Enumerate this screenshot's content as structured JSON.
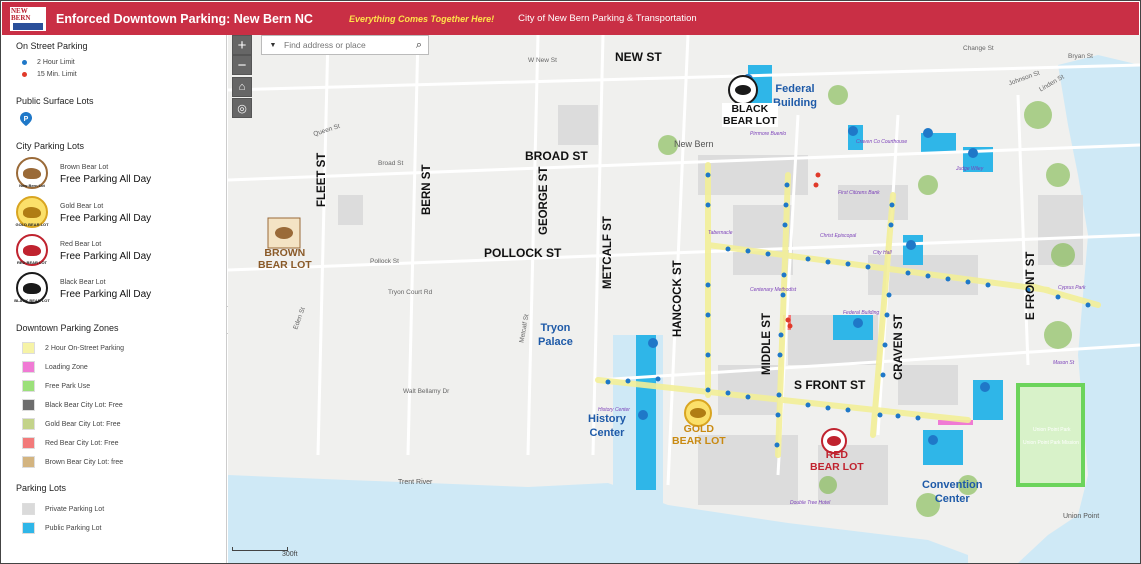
{
  "header": {
    "logo_text": "NEW BERN",
    "title": "Enforced Downtown Parking: New Bern NC",
    "tagline": "Everything Comes Together Here!",
    "link": "City of New Bern Parking & Transportation"
  },
  "legend": {
    "on_street": {
      "heading": "On Street Parking",
      "items": [
        {
          "label": "2 Hour Limit",
          "color": "#1f78c8"
        },
        {
          "label": "15 Min. Limit",
          "color": "#e03a2a"
        }
      ]
    },
    "surface_lots": {
      "heading": "Public Surface Lots"
    },
    "city_lots": {
      "heading": "City Parking Lots",
      "items": [
        {
          "label": "Brown Bear Lot",
          "free": "Free Parking All Day",
          "badge": "New Bern Lot",
          "color": "#9a6a38"
        },
        {
          "label": "Gold Bear Lot",
          "free": "Free Parking All Day",
          "badge": "GOLD BEAR LOT",
          "color": "#d9a521"
        },
        {
          "label": "Red Bear Lot",
          "free": "Free Parking All Day",
          "badge": "RED BEAR LOT",
          "color": "#c0232f"
        },
        {
          "label": "Black Bear Lot",
          "free": "Free Parking All Day",
          "badge": "BLACK BEAR LOT",
          "color": "#1a1a1a"
        }
      ]
    },
    "zones": {
      "heading": "Downtown Parking Zones",
      "items": [
        {
          "label": "2 Hour On-Street Parking",
          "color": "#f6f3a6"
        },
        {
          "label": "Loading Zone",
          "color": "#f07ad4"
        },
        {
          "label": "Free Park Use",
          "color": "#9be07a"
        },
        {
          "label": "Black Bear City Lot: Free",
          "color": "#6d6d6d"
        },
        {
          "label": "Gold Bear City Lot: Free",
          "color": "#c3d38a"
        },
        {
          "label": "Red Bear City Lot: Free",
          "color": "#f27a7a"
        },
        {
          "label": "Brown Bear City Lot: free",
          "color": "#d3b480"
        }
      ]
    },
    "lots": {
      "heading": "Parking Lots",
      "items": [
        {
          "label": "Private Parking Lot",
          "color": "#dadada"
        },
        {
          "label": "Public Parking Lot",
          "color": "#2fb6e8"
        }
      ]
    }
  },
  "map": {
    "search_placeholder": "Find address or place",
    "scale_label": "300ft",
    "streets": {
      "new": "NEW ST",
      "broad": "BROAD ST",
      "pollock": "POLLOCK ST",
      "fleet": "FLEET ST",
      "bern": "BERN ST",
      "george": "GEORGE ST",
      "metcalf": "METCALF ST",
      "hancock": "HANCOCK ST",
      "middle": "MIDDLE ST",
      "craven": "CRAVEN ST",
      "sfront": "S FRONT ST",
      "efront": "E FRONT ST"
    },
    "places": {
      "federal": "Federal\nBuilding",
      "tryon": "Tryon\nPalace",
      "history": "History\nCenter",
      "convention": "Convention\nCenter",
      "newbern": "New Bern",
      "trent": "Trent River",
      "unionpt": "Union Point"
    },
    "lot_labels": {
      "black": "BLACK\nBEAR LOT",
      "brown": "BROWN\nBEAR LOT",
      "gold": "GOLD\nBEAR LOT",
      "red": "RED\nBEAR LOT"
    },
    "small_streets": [
      "W New St",
      "Queen St",
      "Broad St",
      "Pollock St",
      "Johnson St",
      "Change St",
      "Bryan St",
      "Linden St",
      "Tryon Court Rd",
      "Eden St",
      "Metcalf St",
      "Walt Bellamy Dr"
    ],
    "small_labels": [
      "Craven Co Courthouse",
      "Judge Wiley",
      "First Citizens Bank",
      "Christ Episcopal",
      "City Hall",
      "Tabernacle",
      "Centenary Methodist",
      "Cyprus Park",
      "Federal Building",
      "Pirrmore Buenlo",
      "Mason St",
      "History Center",
      "Double Tree Hotel",
      "Union Point Park",
      "Union Point Park Mission"
    ]
  }
}
